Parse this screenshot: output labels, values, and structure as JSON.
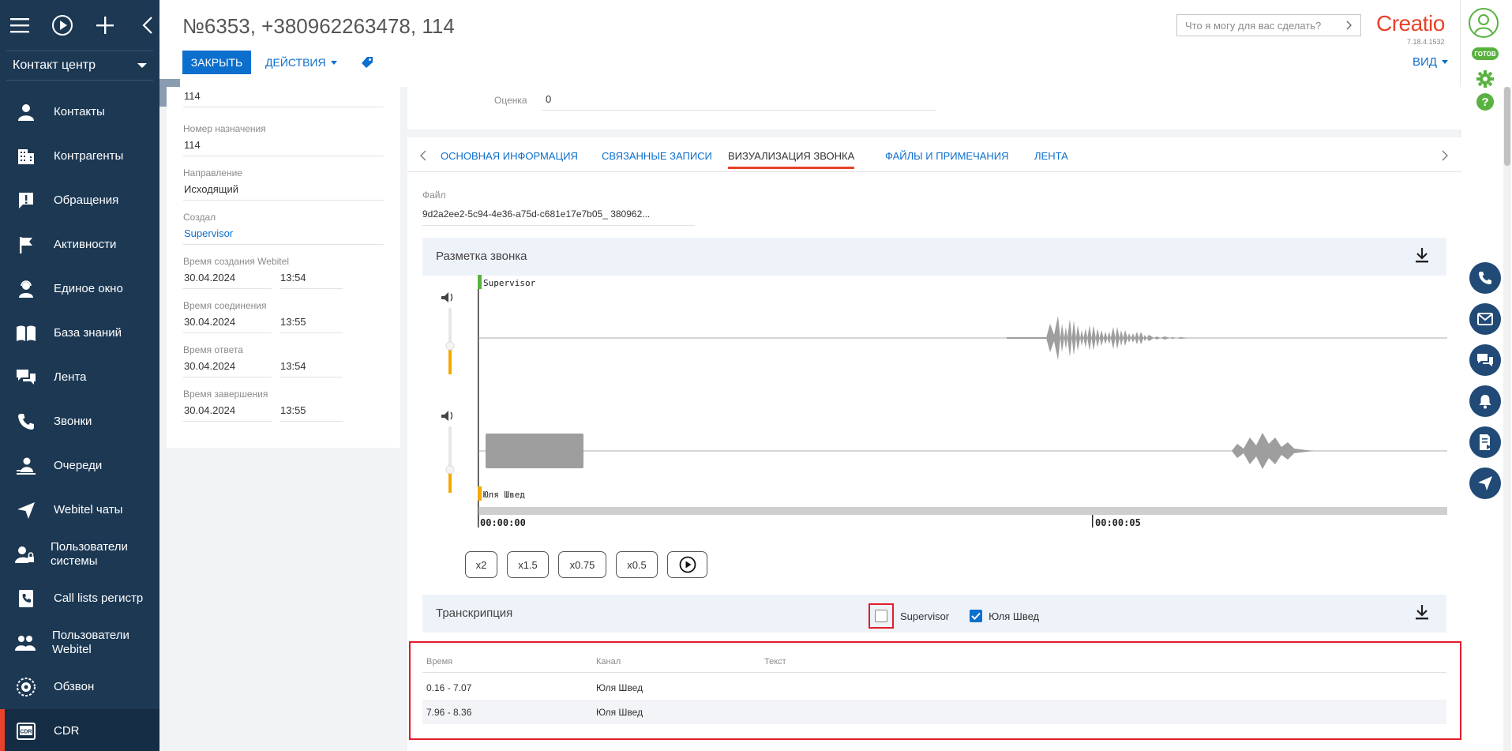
{
  "sidebar": {
    "workspace": "Контакт центр",
    "items": [
      {
        "label": "Контакты",
        "icon": "person-icon"
      },
      {
        "label": "Контрагенты",
        "icon": "building-icon"
      },
      {
        "label": "Обращения",
        "icon": "exclamation-icon"
      },
      {
        "label": "Активности",
        "icon": "flag-icon"
      },
      {
        "label": "Единое окно",
        "icon": "agent-icon"
      },
      {
        "label": "База знаний",
        "icon": "book-icon"
      },
      {
        "label": "Лента",
        "icon": "chat-icon"
      },
      {
        "label": "Звонки",
        "icon": "phone-icon"
      },
      {
        "label": "Очереди",
        "icon": "queue-icon"
      },
      {
        "label": "Webitel чаты",
        "icon": "send-icon"
      },
      {
        "label": "Пользователи системы",
        "icon": "user-lock-icon"
      },
      {
        "label": "Call lists регистр",
        "icon": "phone-book-icon"
      },
      {
        "label": "Пользователи Webitel",
        "icon": "users-icon"
      },
      {
        "label": "Обзвон",
        "icon": "dialer-icon"
      },
      {
        "label": "CDR",
        "icon": "cdr-icon"
      }
    ],
    "active": "CDR"
  },
  "header": {
    "title": "№6353, +380962263478, 114",
    "close_label": "ЗАКРЫТЬ",
    "actions_label": "ДЕЙСТВИЯ",
    "search_placeholder": "Что я могу для вас сделать?",
    "logo": "Creatio",
    "version": "7.18.4.1532",
    "view_label": "ВИД"
  },
  "rightbar": {
    "status": "ГОТОВ"
  },
  "details": {
    "field0_value": "114",
    "destination_label": "Номер назначения",
    "destination_value": "114",
    "direction_label": "Направление",
    "direction_value": "Исходящий",
    "created_by_label": "Создал",
    "created_by_value": "Supervisor",
    "created_webitel_label": "Время создания Webitel",
    "created_webitel_date": "30.04.2024",
    "created_webitel_time": "13:54",
    "connect_label": "Время соединения",
    "connect_date": "30.04.2024",
    "connect_time": "13:55",
    "answer_label": "Время ответа",
    "answer_date": "30.04.2024",
    "answer_time": "13:54",
    "end_label": "Время завершения",
    "end_date": "30.04.2024",
    "end_time": "13:55"
  },
  "rating": {
    "label": "Оценка",
    "value": "0"
  },
  "tabs": [
    "ОСНОВНАЯ ИНФОРМАЦИЯ",
    "СВЯЗАННЫЕ ЗАПИСИ",
    "ВИЗУАЛИЗАЦИЯ ЗВОНКА",
    "ФАЙЛЫ И ПРИМЕЧАНИЯ",
    "ЛЕНТА"
  ],
  "active_tab": "ВИЗУАЛИЗАЦИЯ ЗВОНКА",
  "file": {
    "label": "Файл",
    "value": "9d2a2ee2-5c94-4e36-a75d-c681e17e7b05_ 380962..."
  },
  "markup": {
    "title": "Разметка звонка",
    "channel1": "Supervisor",
    "channel2": "Юля Швед",
    "time_start": "00:00:00",
    "time_mid": "00:00:05",
    "channel1_volume": 0.43,
    "channel2_volume": 0.35
  },
  "speeds": [
    "x2",
    "x1.5",
    "x0.75",
    "x0.5"
  ],
  "transcription": {
    "title": "Транскрипция",
    "filters": [
      {
        "label": "Supervisor",
        "checked": false
      },
      {
        "label": "Юля Швед",
        "checked": true
      }
    ],
    "columns": [
      "Время",
      "Канал",
      "Текст"
    ],
    "rows": [
      {
        "time": "0.16 - 7.07",
        "channel": "Юля Швед",
        "text": ""
      },
      {
        "time": "7.96 - 8.36",
        "channel": "Юля Швед",
        "text": ""
      }
    ]
  },
  "colors": {
    "sidebar_bg": "#1c3853",
    "accent_blue": "#0d6fcd",
    "brand_red": "#e8422a",
    "status_green": "#59b240",
    "highlight_red": "#e11d2a"
  }
}
